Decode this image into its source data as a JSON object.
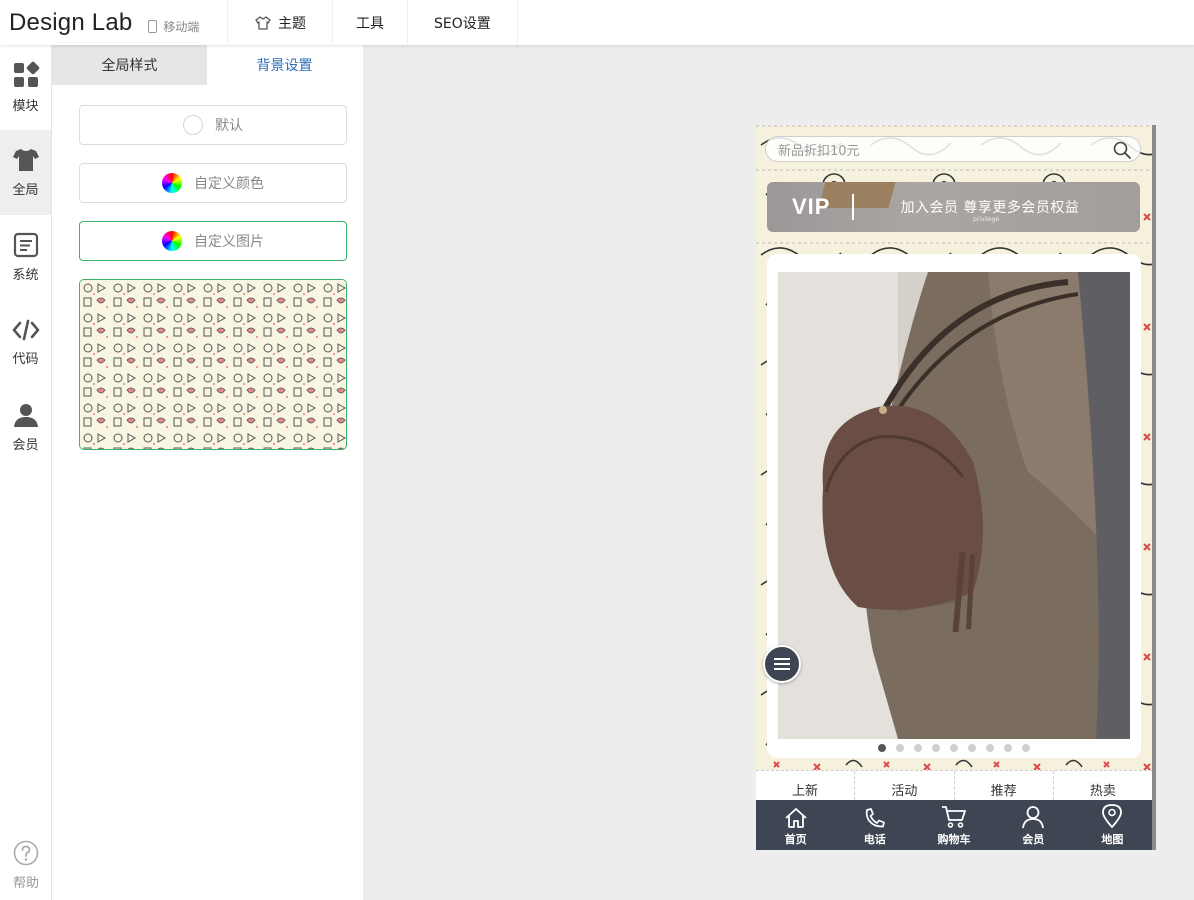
{
  "app": {
    "title": "Design Lab",
    "mode_label": "移动端"
  },
  "topnav": [
    {
      "label": "主题",
      "icon": "theme-icon"
    },
    {
      "label": "工具",
      "icon": ""
    },
    {
      "label": "SEO设置",
      "icon": ""
    }
  ],
  "rail": [
    {
      "label": "模块",
      "icon": "modules-icon",
      "active": false
    },
    {
      "label": "全局",
      "icon": "shirt-icon",
      "active": true
    },
    {
      "label": "系统",
      "icon": "document-icon",
      "active": false
    },
    {
      "label": "代码",
      "icon": "code-icon",
      "active": false
    },
    {
      "label": "会员",
      "icon": "user-icon",
      "active": false
    }
  ],
  "help_label": "帮助",
  "tabs": [
    {
      "label": "全局样式",
      "active": false
    },
    {
      "label": "背景设置",
      "active": true
    }
  ],
  "background_options": [
    {
      "label": "默认",
      "icon": "empty-circle-icon",
      "selected": false
    },
    {
      "label": "自定义颜色",
      "icon": "color-wheel-icon",
      "selected": false
    },
    {
      "label": "自定义图片",
      "icon": "color-wheel-icon",
      "selected": true
    }
  ],
  "preview": {
    "search_placeholder": "新品折扣10元",
    "vip_label": "VIP",
    "vip_text": "加入会员 尊享更多会员权益",
    "vip_sub": "privilege",
    "banner_dot_count": 9,
    "banner_active_dot": 0,
    "categories": [
      "上新",
      "活动",
      "推荐",
      "热卖"
    ],
    "bottom_nav": [
      {
        "label": "首页",
        "icon": "home-icon"
      },
      {
        "label": "电话",
        "icon": "phone-icon"
      },
      {
        "label": "购物车",
        "icon": "cart-icon"
      },
      {
        "label": "会员",
        "icon": "member-icon"
      },
      {
        "label": "地图",
        "icon": "map-pin-icon"
      }
    ]
  },
  "colors": {
    "accent_blue": "#2c6eb8",
    "selected_green": "#39b16a",
    "nav_dark": "#3e4553",
    "pattern_bg": "#f5f1dc"
  }
}
